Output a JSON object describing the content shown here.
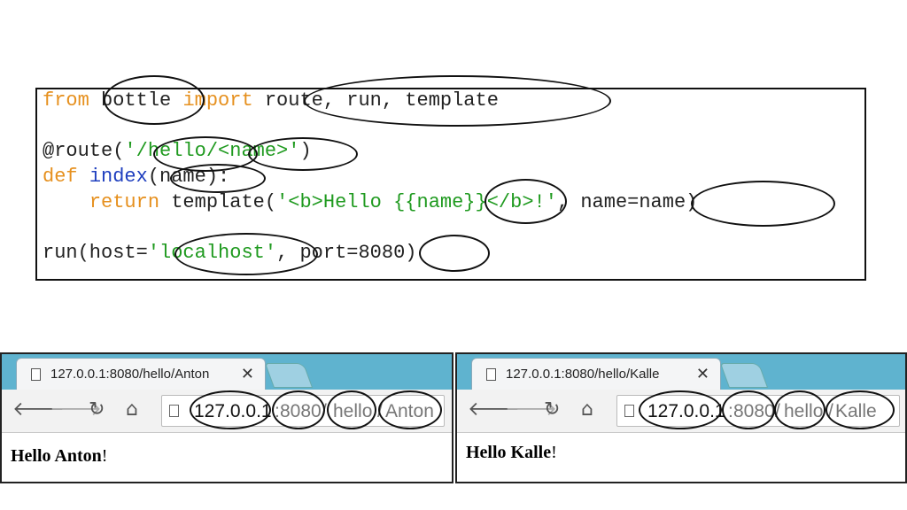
{
  "code": {
    "line1": {
      "kw_from": "from",
      "module": "bottle",
      "kw_import": "import",
      "names": "route, run, template"
    },
    "line2": {
      "decorator": "@route(",
      "q_open": "'",
      "path_a": "/hello/",
      "path_b": "<name>",
      "q_close": "'",
      "close": ")"
    },
    "line3": {
      "kw_def": "def",
      "fname": "index",
      "args": "(name):"
    },
    "line4": {
      "kw_return": "return",
      "call": "template(",
      "str_a": "'<b>Hello ",
      "str_b": "{{name}}",
      "str_c": "</b>!'",
      "comma": ", ",
      "kwarg": "name=name",
      "close": ")"
    },
    "line5": {
      "call": "run(host=",
      "q_open": "'",
      "host": "localhost",
      "q_close": "'",
      "port_kw": ", port=",
      "port": "8080",
      "close": ")"
    }
  },
  "browser_left": {
    "tab_title": "127.0.0.1:8080/hello/Anton",
    "tab_close": "✕",
    "nav": {
      "back": "🡐",
      "forward": "🡒",
      "reload": "↻",
      "home": "⌂"
    },
    "url": {
      "host": "127.0.0.1",
      "sep1": ":",
      "port": "8080",
      "sep2": "/",
      "path": "hello",
      "sep3": "/",
      "name": "Anton"
    },
    "content": {
      "bold": "Hello Anton",
      "tail": "!"
    }
  },
  "browser_right": {
    "tab_title": "127.0.0.1:8080/hello/Kalle",
    "tab_close": "✕",
    "nav": {
      "back": "🡐",
      "forward": "🡒",
      "reload": "↻",
      "home": "⌂"
    },
    "url": {
      "host": "127.0.0.1",
      "sep1": ":",
      "port": "8080",
      "sep2": "/",
      "path": "hello",
      "sep3": "/",
      "name": "Kalle"
    },
    "content": {
      "bold": "Hello Kalle",
      "tail": "!"
    }
  }
}
